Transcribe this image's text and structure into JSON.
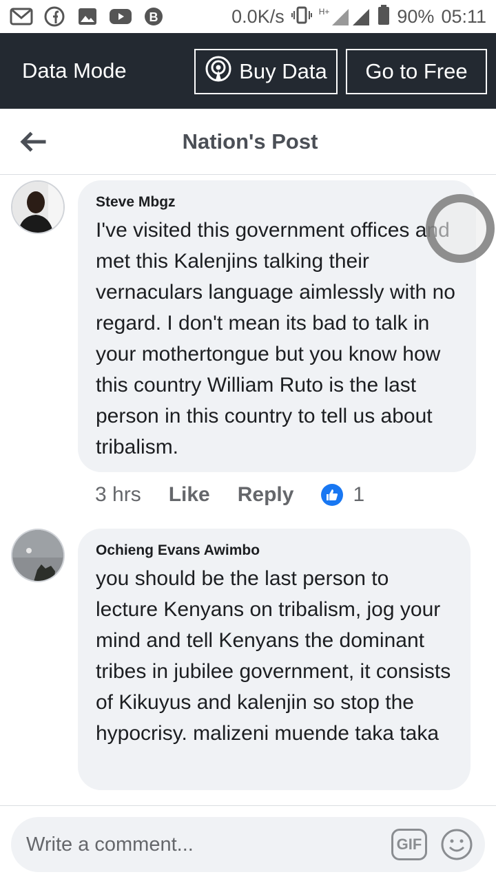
{
  "status_bar": {
    "network_speed": "0.0K/s",
    "network_type": "H+",
    "battery": "90%",
    "time": "05:11",
    "left_icons": [
      "gmail-icon",
      "facebook-icon",
      "gallery-icon",
      "youtube-icon",
      "bitcoin-icon"
    ]
  },
  "data_mode_bar": {
    "title": "Data Mode",
    "buy_data_label": "Buy Data",
    "go_free_label": "Go to Free"
  },
  "header": {
    "title": "Nation's Post"
  },
  "comments": [
    {
      "author": "Steve Mbgz",
      "text": "I've visited this government offices and met this Kalenjins talking their vernaculars language aimlessly with no regard. I don't mean its bad to talk in your mothertongue but you know how this country William Ruto is the last person in this country to tell us about tribalism.",
      "time": "3 hrs",
      "like_label": "Like",
      "reply_label": "Reply",
      "reaction_count": "1"
    },
    {
      "author": "Ochieng Evans Awimbo",
      "text": "you should be the last person to lecture Kenyans on tribalism, jog your mind and tell Kenyans the dominant tribes in jubilee government, it consists of Kikuyus and kalenjin so stop the hypocrisy. malizeni muende taka taka"
    }
  ],
  "composer": {
    "placeholder": "Write a comment...",
    "gif_label": "GIF"
  },
  "colors": {
    "data_bar": "#232931",
    "bubble": "#f0f2f5",
    "like_blue": "#1877f2"
  }
}
